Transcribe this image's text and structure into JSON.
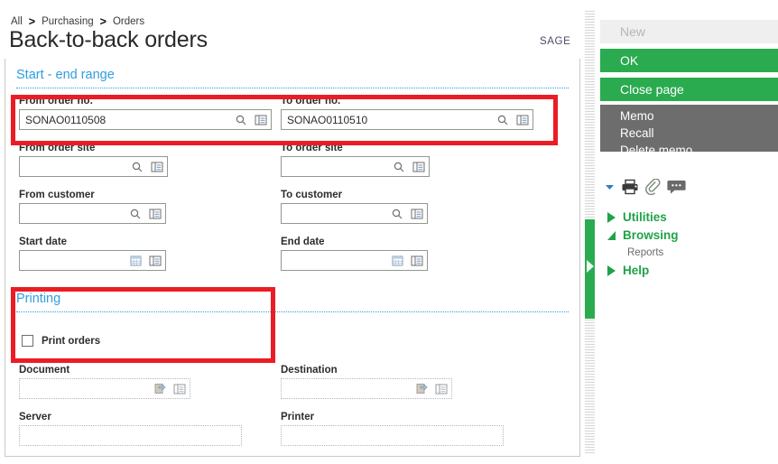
{
  "breadcrumb": {
    "items": [
      "All",
      "Purchasing",
      "Orders"
    ],
    "separator": ">"
  },
  "page_title": "Back-to-back orders",
  "brand": "SAGE",
  "sections": {
    "range": {
      "heading": "Start - end range"
    },
    "printing": {
      "heading": "Printing"
    }
  },
  "fields": {
    "from_order_no": {
      "label": "From order no.",
      "value": "SONAO0110508",
      "icons": [
        "search-icon",
        "lookup-list-icon"
      ]
    },
    "to_order_no": {
      "label": "To order no.",
      "value": "SONAO0110510",
      "icons": [
        "search-icon",
        "lookup-list-icon"
      ]
    },
    "from_order_site": {
      "label": "From order site",
      "value": "",
      "icons": [
        "search-icon",
        "lookup-list-icon"
      ]
    },
    "to_order_site": {
      "label": "To order site",
      "value": "",
      "icons": [
        "search-icon",
        "lookup-list-icon"
      ]
    },
    "from_customer": {
      "label": "From customer",
      "value": "",
      "icons": [
        "search-icon",
        "lookup-list-icon"
      ]
    },
    "to_customer": {
      "label": "To customer",
      "value": "",
      "icons": [
        "search-icon",
        "lookup-list-icon"
      ]
    },
    "start_date": {
      "label": "Start date",
      "value": "",
      "icons": [
        "calendar-icon",
        "lookup-list-icon"
      ]
    },
    "end_date": {
      "label": "End date",
      "value": "",
      "icons": [
        "calendar-icon",
        "lookup-list-icon"
      ]
    },
    "document": {
      "label": "Document",
      "value": "",
      "disabled": true,
      "icons": [
        "selection-icon",
        "lookup-list-icon"
      ]
    },
    "destination": {
      "label": "Destination",
      "value": "",
      "disabled": true,
      "icons": [
        "selection-icon",
        "lookup-list-icon"
      ]
    },
    "server": {
      "label": "Server",
      "value": "",
      "disabled": true,
      "icons": []
    },
    "printer": {
      "label": "Printer",
      "value": "",
      "disabled": true,
      "icons": []
    }
  },
  "print_orders": {
    "label": "Print orders",
    "checked": false
  },
  "right_panel": {
    "actions": [
      {
        "label": "New",
        "state": "disabled"
      },
      {
        "label": "OK",
        "state": "primary"
      },
      {
        "label": "Close page",
        "state": "primary"
      }
    ],
    "memo_menu": [
      "Memo",
      "Recall",
      "Delete memo"
    ],
    "icons": [
      "chevron-down-icon",
      "printer-icon",
      "attachment-icon",
      "comment-icon"
    ],
    "nav": [
      {
        "label": "Utilities",
        "expanded": false
      },
      {
        "label": "Browsing",
        "expanded": true
      },
      {
        "label": "Help",
        "expanded": false
      }
    ],
    "nav_sub": "Reports"
  },
  "annotations": {
    "order_range_highlight": "red-box",
    "printing_highlight": "red-box"
  },
  "colors": {
    "accent_green": "#2aab4f",
    "section_blue": "#2f9ede",
    "annotation_red": "#ec1c24",
    "memo_gray": "#6d6d6d"
  }
}
